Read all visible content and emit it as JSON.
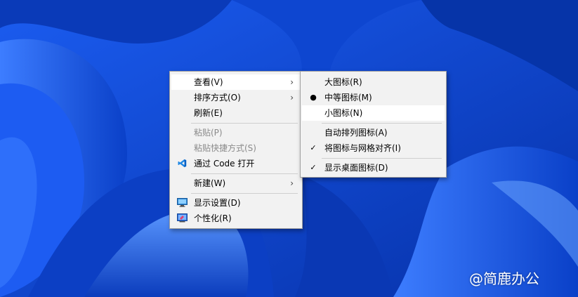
{
  "colors": {
    "desktop_deep": "#062a9a",
    "desktop_mid": "#0d52e0",
    "desktop_light": "#4b8cff",
    "menu_bg": "#f2f2f2",
    "highlight_bg": "#ffffff",
    "disabled_text": "#8a8a8a"
  },
  "context_menu": {
    "items": [
      {
        "label": "查看(V)",
        "submenu": true,
        "highlighted": true
      },
      {
        "label": "排序方式(O)",
        "submenu": true
      },
      {
        "label": "刷新(E)"
      },
      {
        "label": "粘贴(P)",
        "disabled": true
      },
      {
        "label": "粘贴快捷方式(S)",
        "disabled": true
      },
      {
        "label": "通过 Code 打开",
        "icon": "vscode-icon"
      },
      {
        "label": "新建(W)",
        "submenu": true
      },
      {
        "label": "显示设置(D)",
        "icon": "display-settings-icon"
      },
      {
        "label": "个性化(R)",
        "icon": "personalize-icon"
      }
    ],
    "arrow_glyph": "›"
  },
  "view_submenu": {
    "items": [
      {
        "label": "大图标(R)"
      },
      {
        "label": "中等图标(M)",
        "mark": "●"
      },
      {
        "label": "小图标(N)",
        "highlighted": true
      },
      {
        "label": "自动排列图标(A)"
      },
      {
        "label": "将图标与网格对齐(I)",
        "mark": "✓"
      },
      {
        "label": "显示桌面图标(D)",
        "mark": "✓"
      }
    ]
  },
  "watermark": {
    "text": "@简鹿办公",
    "icon": "paw-icon"
  }
}
